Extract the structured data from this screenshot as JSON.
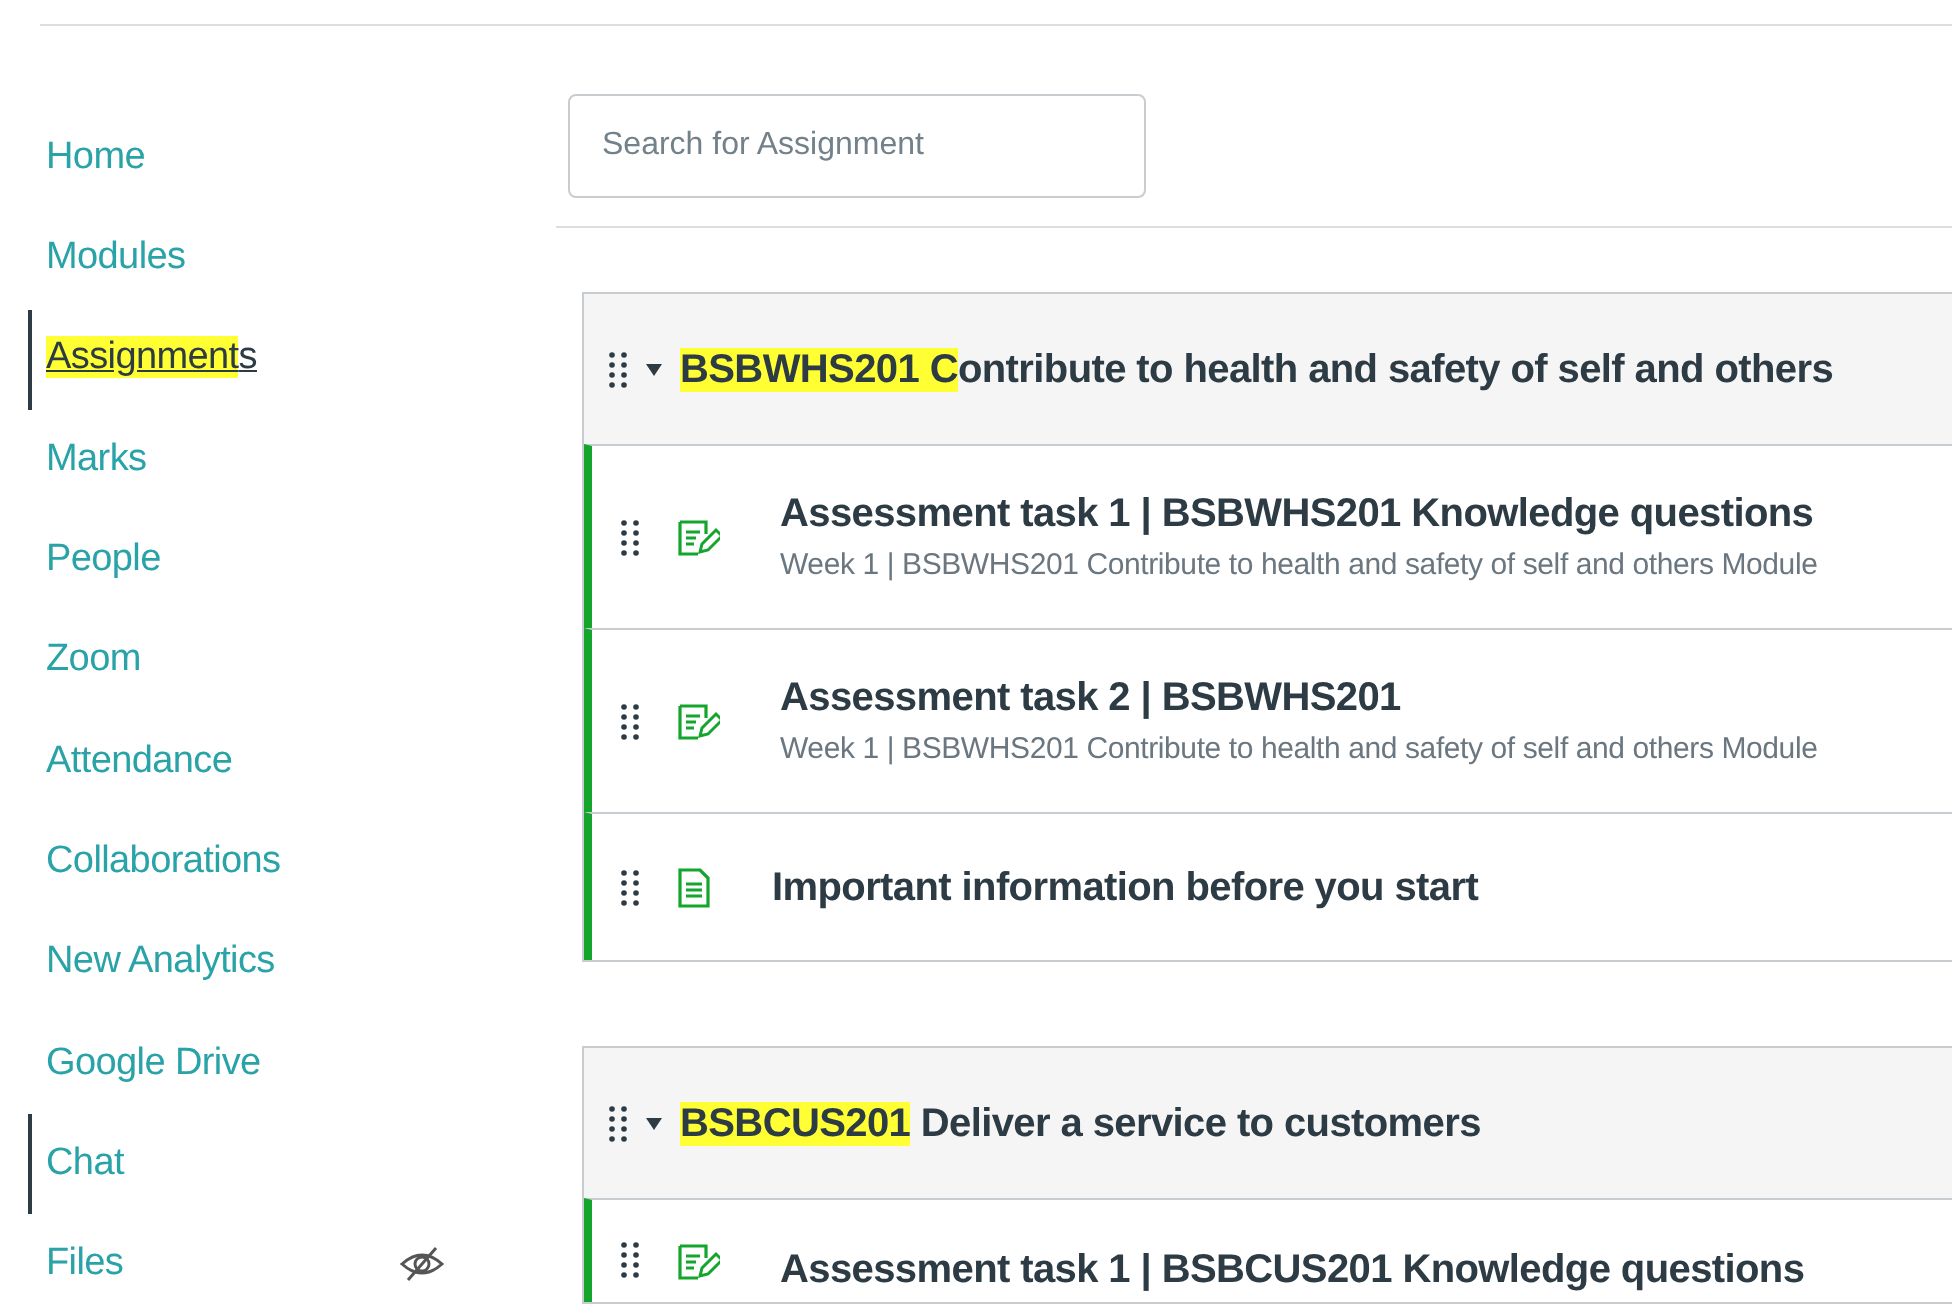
{
  "sidebar": {
    "items": [
      {
        "label": [
          {
            "text": "Home",
            "highlighted": false
          }
        ],
        "selected": false,
        "marker": false,
        "hidden": false
      },
      {
        "label": [
          {
            "text": "Modules",
            "highlighted": false
          }
        ],
        "selected": false,
        "marker": false,
        "hidden": false
      },
      {
        "label": [
          {
            "text": "Assignment",
            "highlighted": true
          },
          {
            "text": "s",
            "highlighted": false
          }
        ],
        "selected": true,
        "marker": true,
        "hidden": false
      },
      {
        "label": [
          {
            "text": "Marks",
            "highlighted": false
          }
        ],
        "selected": false,
        "marker": false,
        "hidden": false
      },
      {
        "label": [
          {
            "text": "People",
            "highlighted": false
          }
        ],
        "selected": false,
        "marker": false,
        "hidden": false
      },
      {
        "label": [
          {
            "text": "Zoom",
            "highlighted": false
          }
        ],
        "selected": false,
        "marker": false,
        "hidden": false
      },
      {
        "label": [
          {
            "text": "Attendance",
            "highlighted": false
          }
        ],
        "selected": false,
        "marker": false,
        "hidden": false
      },
      {
        "label": [
          {
            "text": "Collaborations",
            "highlighted": false
          }
        ],
        "selected": false,
        "marker": false,
        "hidden": false
      },
      {
        "label": [
          {
            "text": "New Analytics",
            "highlighted": false
          }
        ],
        "selected": false,
        "marker": false,
        "hidden": false
      },
      {
        "label": [
          {
            "text": "Google Drive",
            "highlighted": false
          }
        ],
        "selected": false,
        "marker": false,
        "hidden": false
      },
      {
        "label": [
          {
            "text": "Chat",
            "highlighted": false
          }
        ],
        "selected": false,
        "marker": true,
        "hidden": false
      },
      {
        "label": [
          {
            "text": "Files",
            "highlighted": false
          }
        ],
        "selected": false,
        "marker": false,
        "hidden": true
      }
    ]
  },
  "search": {
    "placeholder": "Search for Assignment"
  },
  "groups": [
    {
      "title": [
        {
          "text": "BSBWHS201 C",
          "highlighted": true
        },
        {
          "text": "ontribute to health and safety of self and others",
          "highlighted": false
        }
      ],
      "expanded": true,
      "items": [
        {
          "kind": "assignment",
          "title": "Assessment task 1 | BSBWHS201 Knowledge questions",
          "subtitle": "Week 1 | BSBWHS201 Contribute to health and safety of self and others Module"
        },
        {
          "kind": "assignment",
          "title": "Assessment task 2 | BSBWHS201",
          "subtitle": "Week 1 | BSBWHS201 Contribute to health and safety of self and others Module"
        },
        {
          "kind": "page",
          "title": "Important information before you start"
        }
      ]
    },
    {
      "title": [
        {
          "text": "BSBCUS201",
          "highlighted": true
        },
        {
          "text": " Deliver a service to customers",
          "highlighted": false
        }
      ],
      "expanded": true,
      "items": [
        {
          "kind": "assignment",
          "title": "Assessment task 1 | BSBCUS201 Knowledge questions"
        }
      ]
    }
  ]
}
